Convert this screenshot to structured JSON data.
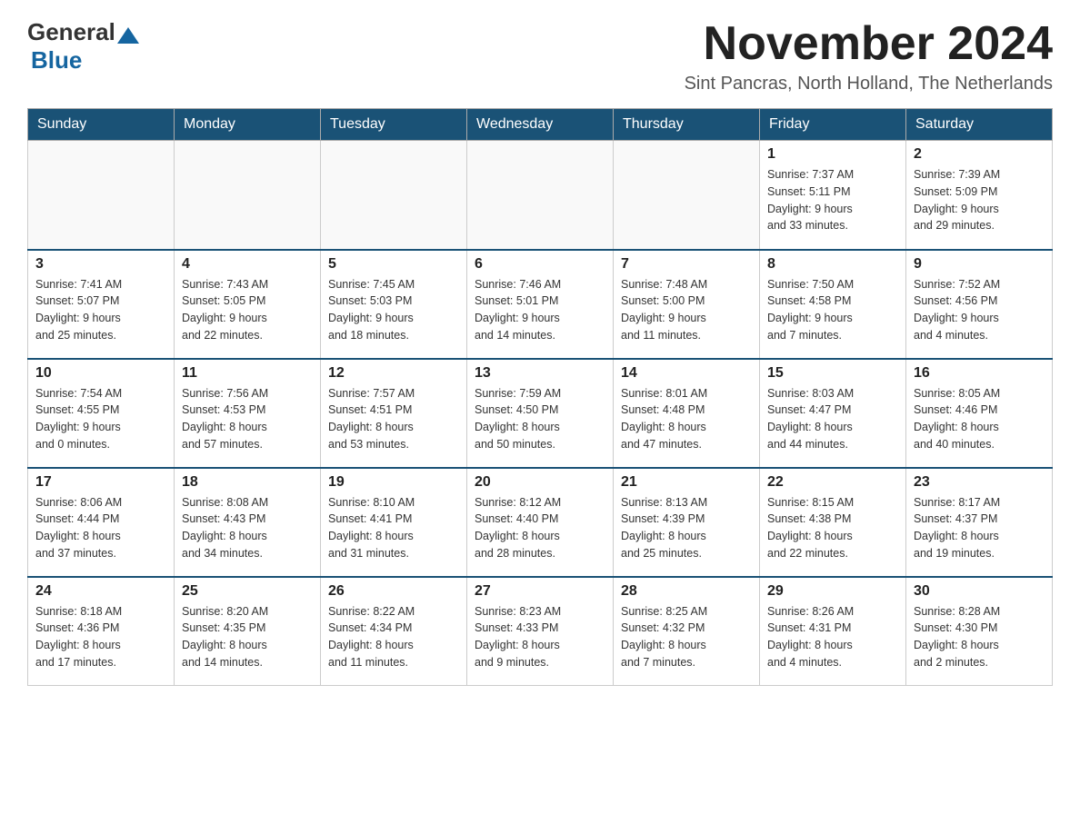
{
  "header": {
    "logo_general": "General",
    "logo_blue": "Blue",
    "month_title": "November 2024",
    "location": "Sint Pancras, North Holland, The Netherlands"
  },
  "weekdays": [
    "Sunday",
    "Monday",
    "Tuesday",
    "Wednesday",
    "Thursday",
    "Friday",
    "Saturday"
  ],
  "weeks": [
    [
      {
        "day": "",
        "info": ""
      },
      {
        "day": "",
        "info": ""
      },
      {
        "day": "",
        "info": ""
      },
      {
        "day": "",
        "info": ""
      },
      {
        "day": "",
        "info": ""
      },
      {
        "day": "1",
        "info": "Sunrise: 7:37 AM\nSunset: 5:11 PM\nDaylight: 9 hours\nand 33 minutes."
      },
      {
        "day": "2",
        "info": "Sunrise: 7:39 AM\nSunset: 5:09 PM\nDaylight: 9 hours\nand 29 minutes."
      }
    ],
    [
      {
        "day": "3",
        "info": "Sunrise: 7:41 AM\nSunset: 5:07 PM\nDaylight: 9 hours\nand 25 minutes."
      },
      {
        "day": "4",
        "info": "Sunrise: 7:43 AM\nSunset: 5:05 PM\nDaylight: 9 hours\nand 22 minutes."
      },
      {
        "day": "5",
        "info": "Sunrise: 7:45 AM\nSunset: 5:03 PM\nDaylight: 9 hours\nand 18 minutes."
      },
      {
        "day": "6",
        "info": "Sunrise: 7:46 AM\nSunset: 5:01 PM\nDaylight: 9 hours\nand 14 minutes."
      },
      {
        "day": "7",
        "info": "Sunrise: 7:48 AM\nSunset: 5:00 PM\nDaylight: 9 hours\nand 11 minutes."
      },
      {
        "day": "8",
        "info": "Sunrise: 7:50 AM\nSunset: 4:58 PM\nDaylight: 9 hours\nand 7 minutes."
      },
      {
        "day": "9",
        "info": "Sunrise: 7:52 AM\nSunset: 4:56 PM\nDaylight: 9 hours\nand 4 minutes."
      }
    ],
    [
      {
        "day": "10",
        "info": "Sunrise: 7:54 AM\nSunset: 4:55 PM\nDaylight: 9 hours\nand 0 minutes."
      },
      {
        "day": "11",
        "info": "Sunrise: 7:56 AM\nSunset: 4:53 PM\nDaylight: 8 hours\nand 57 minutes."
      },
      {
        "day": "12",
        "info": "Sunrise: 7:57 AM\nSunset: 4:51 PM\nDaylight: 8 hours\nand 53 minutes."
      },
      {
        "day": "13",
        "info": "Sunrise: 7:59 AM\nSunset: 4:50 PM\nDaylight: 8 hours\nand 50 minutes."
      },
      {
        "day": "14",
        "info": "Sunrise: 8:01 AM\nSunset: 4:48 PM\nDaylight: 8 hours\nand 47 minutes."
      },
      {
        "day": "15",
        "info": "Sunrise: 8:03 AM\nSunset: 4:47 PM\nDaylight: 8 hours\nand 44 minutes."
      },
      {
        "day": "16",
        "info": "Sunrise: 8:05 AM\nSunset: 4:46 PM\nDaylight: 8 hours\nand 40 minutes."
      }
    ],
    [
      {
        "day": "17",
        "info": "Sunrise: 8:06 AM\nSunset: 4:44 PM\nDaylight: 8 hours\nand 37 minutes."
      },
      {
        "day": "18",
        "info": "Sunrise: 8:08 AM\nSunset: 4:43 PM\nDaylight: 8 hours\nand 34 minutes."
      },
      {
        "day": "19",
        "info": "Sunrise: 8:10 AM\nSunset: 4:41 PM\nDaylight: 8 hours\nand 31 minutes."
      },
      {
        "day": "20",
        "info": "Sunrise: 8:12 AM\nSunset: 4:40 PM\nDaylight: 8 hours\nand 28 minutes."
      },
      {
        "day": "21",
        "info": "Sunrise: 8:13 AM\nSunset: 4:39 PM\nDaylight: 8 hours\nand 25 minutes."
      },
      {
        "day": "22",
        "info": "Sunrise: 8:15 AM\nSunset: 4:38 PM\nDaylight: 8 hours\nand 22 minutes."
      },
      {
        "day": "23",
        "info": "Sunrise: 8:17 AM\nSunset: 4:37 PM\nDaylight: 8 hours\nand 19 minutes."
      }
    ],
    [
      {
        "day": "24",
        "info": "Sunrise: 8:18 AM\nSunset: 4:36 PM\nDaylight: 8 hours\nand 17 minutes."
      },
      {
        "day": "25",
        "info": "Sunrise: 8:20 AM\nSunset: 4:35 PM\nDaylight: 8 hours\nand 14 minutes."
      },
      {
        "day": "26",
        "info": "Sunrise: 8:22 AM\nSunset: 4:34 PM\nDaylight: 8 hours\nand 11 minutes."
      },
      {
        "day": "27",
        "info": "Sunrise: 8:23 AM\nSunset: 4:33 PM\nDaylight: 8 hours\nand 9 minutes."
      },
      {
        "day": "28",
        "info": "Sunrise: 8:25 AM\nSunset: 4:32 PM\nDaylight: 8 hours\nand 7 minutes."
      },
      {
        "day": "29",
        "info": "Sunrise: 8:26 AM\nSunset: 4:31 PM\nDaylight: 8 hours\nand 4 minutes."
      },
      {
        "day": "30",
        "info": "Sunrise: 8:28 AM\nSunset: 4:30 PM\nDaylight: 8 hours\nand 2 minutes."
      }
    ]
  ]
}
